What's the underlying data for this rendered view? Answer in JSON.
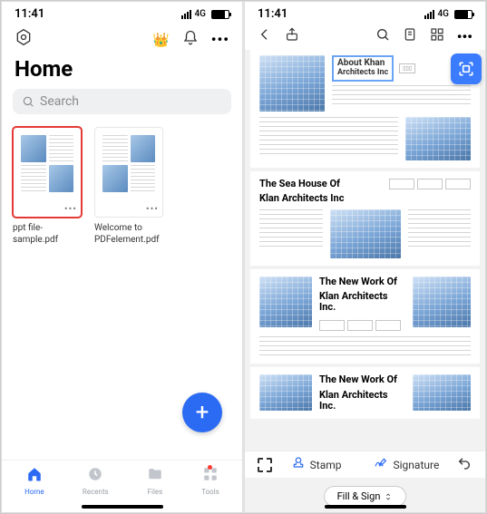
{
  "status": {
    "time": "11:41",
    "network": "4G"
  },
  "left": {
    "title": "Home",
    "search_placeholder": "Search",
    "files": [
      {
        "name": "ppt file-sample.pdf"
      },
      {
        "name": "Welcome to PDFelement.pdf"
      }
    ],
    "tabs": {
      "home": "Home",
      "recents": "Recents",
      "files": "Files",
      "tools": "Tools"
    }
  },
  "right": {
    "doc": {
      "about_title": "About Khan",
      "about_sub": "Architects Inc",
      "sec1_line1": "The Sea House Of",
      "sec1_line2": "Klan Architects Inc",
      "sec2_line1": "The New Work Of",
      "sec2_line2": "Klan Architects Inc.",
      "sec3_line1": "The New Work Of",
      "sec3_line2": "Klan Architects Inc."
    },
    "tools": {
      "stamp": "Stamp",
      "signature": "Signature",
      "fill_sign": "Fill & Sign"
    }
  }
}
